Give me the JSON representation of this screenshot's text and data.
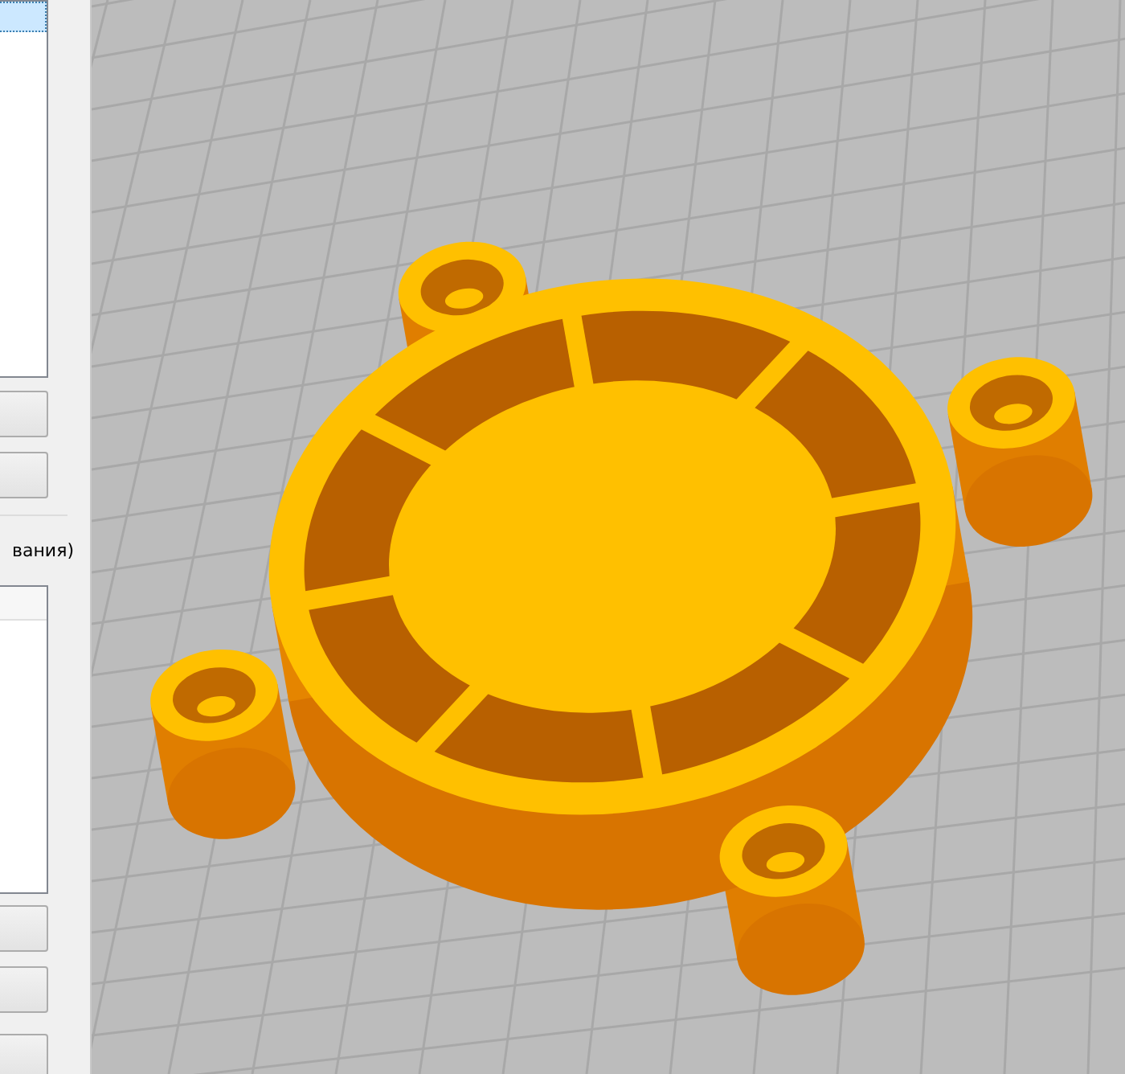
{
  "side_panel": {
    "top_list": {
      "rows": [
        {
          "selected": true
        }
      ]
    },
    "group_label": "вания)"
  }
}
